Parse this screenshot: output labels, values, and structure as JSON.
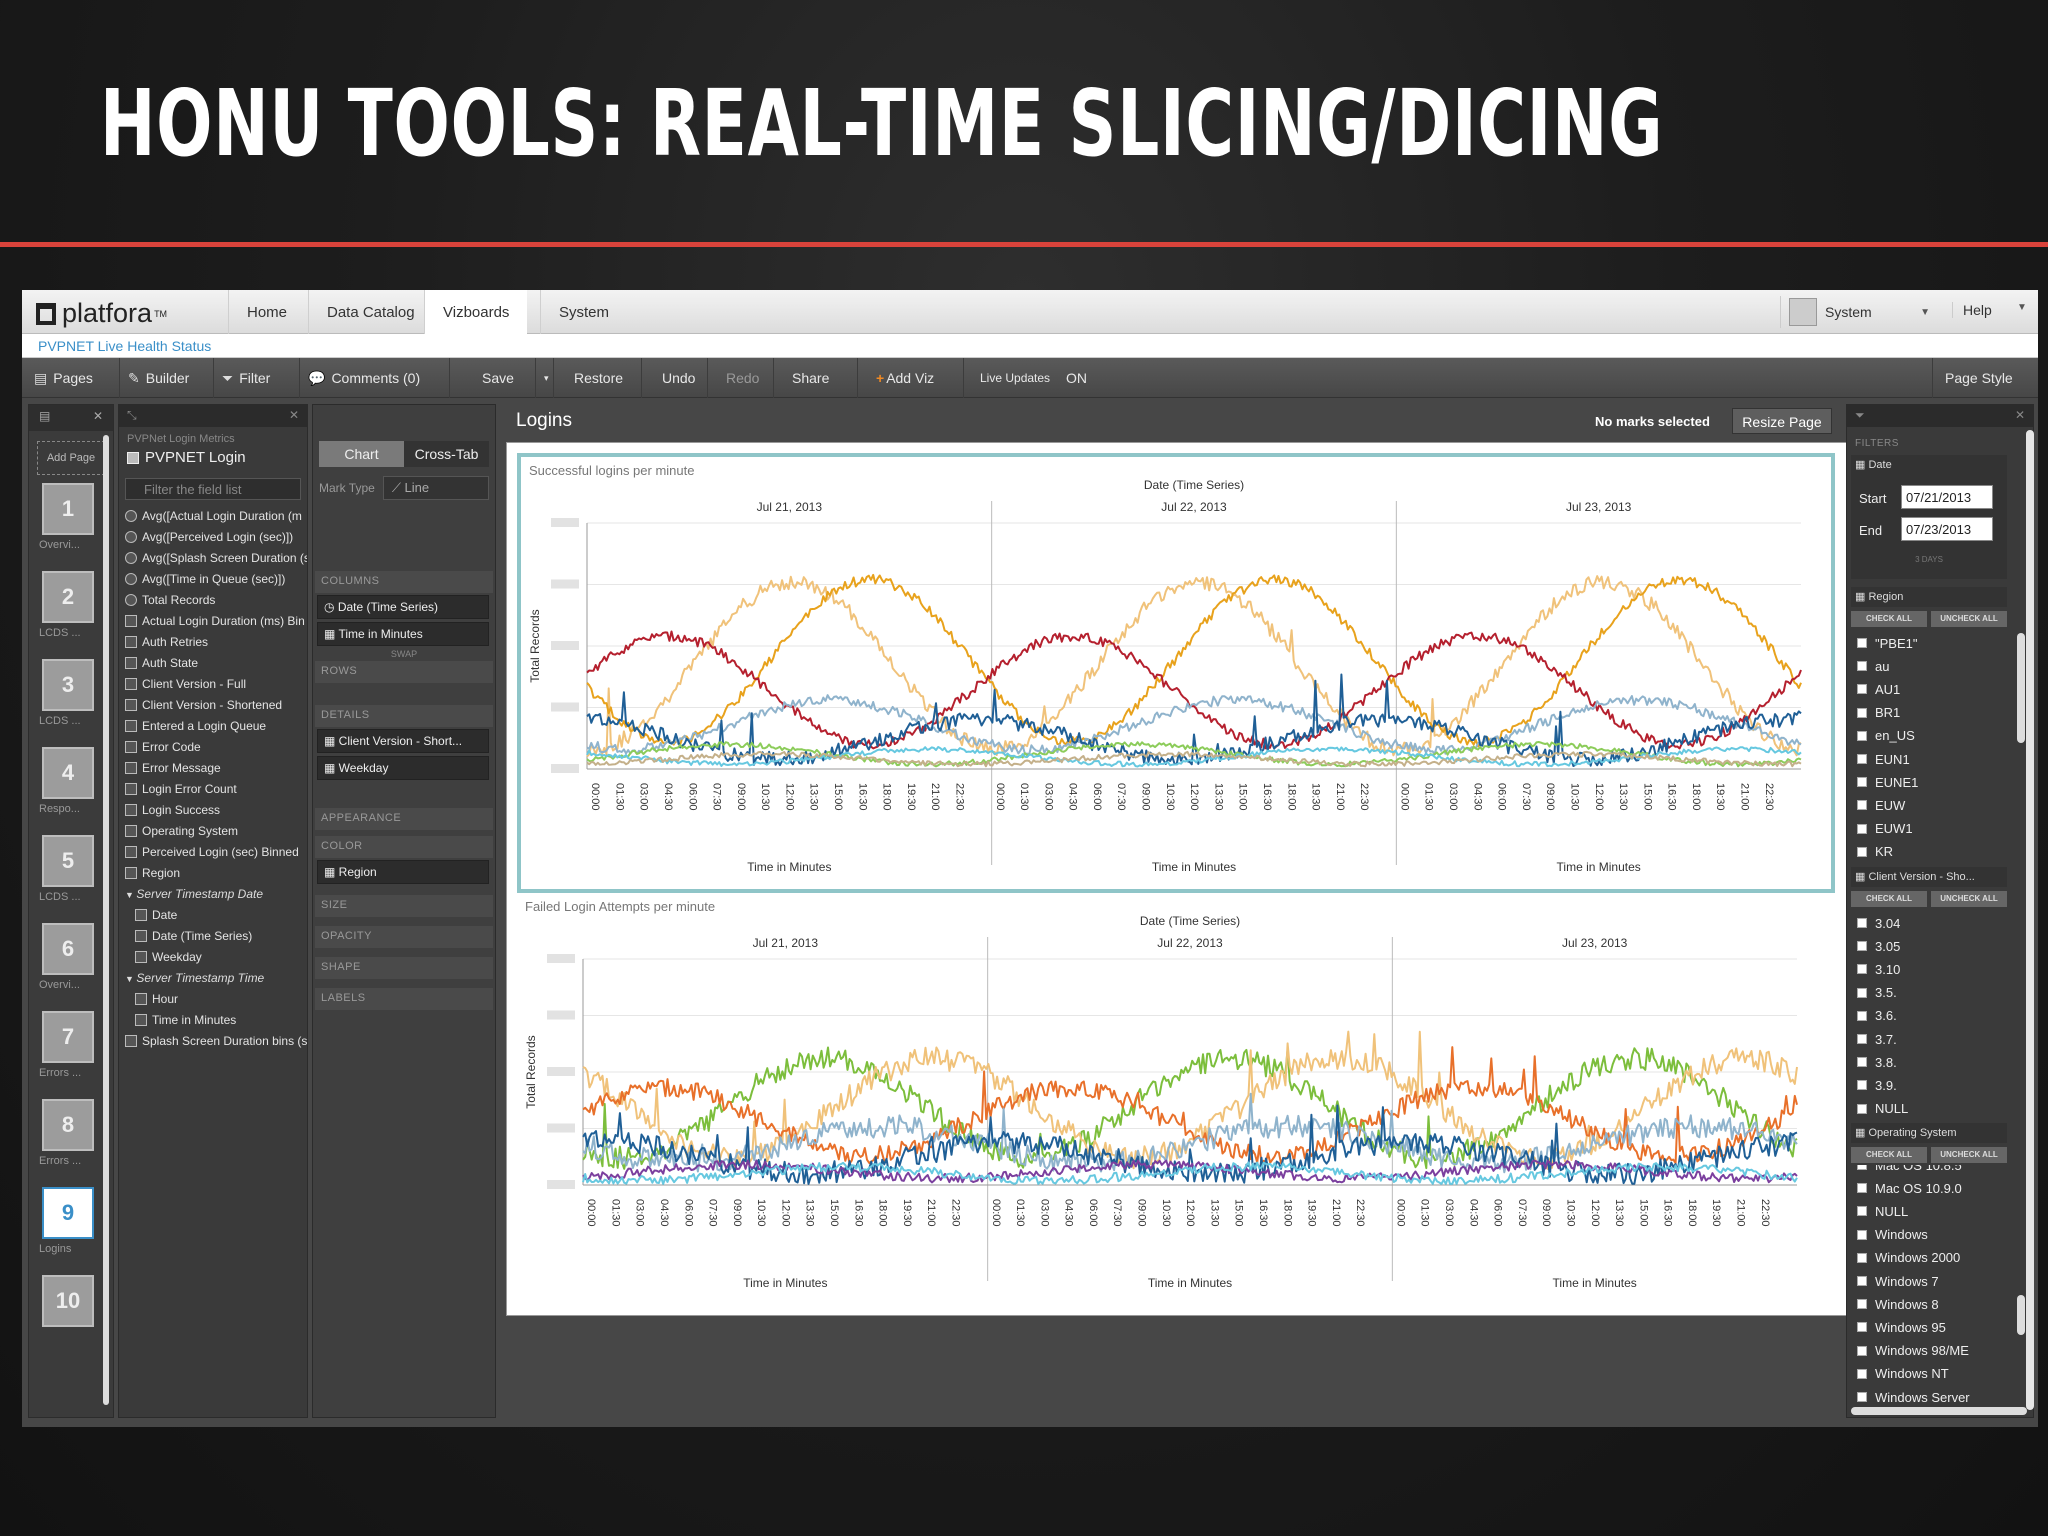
{
  "slide": {
    "title": "HONU TOOLS: REAL-TIME SLICING/DICING"
  },
  "app": {
    "logo": "platfora",
    "logo_mark": "TM",
    "nav": [
      "Home",
      "Data Catalog",
      "Vizboards",
      "System"
    ],
    "active_nav": "Vizboards",
    "user": "System",
    "help": "Help",
    "breadcrumb": "PVPNET Live Health Status"
  },
  "toolbar": {
    "pages": "Pages",
    "builder": "Builder",
    "filter": "Filter",
    "comments": "Comments (0)",
    "save": "Save",
    "restore": "Restore",
    "undo": "Undo",
    "redo": "Redo",
    "share": "Share",
    "add_viz": "Add Viz",
    "live_updates": "Live Updates",
    "live_state": "ON",
    "page_style": "Page Style"
  },
  "pages_panel": {
    "add_page": "Add Page",
    "pages": [
      {
        "num": "1",
        "label": "Overvi..."
      },
      {
        "num": "2",
        "label": "LCDS ..."
      },
      {
        "num": "3",
        "label": "LCDS ..."
      },
      {
        "num": "4",
        "label": "Respo..."
      },
      {
        "num": "5",
        "label": "LCDS ..."
      },
      {
        "num": "6",
        "label": "Overvi..."
      },
      {
        "num": "7",
        "label": "Errors ..."
      },
      {
        "num": "8",
        "label": "Errors ..."
      },
      {
        "num": "9",
        "label": "Logins"
      },
      {
        "num": "10",
        "label": ""
      }
    ],
    "active": "9"
  },
  "fields_panel": {
    "subtitle": "PVPNet Login Metrics",
    "dataset": "PVPNET Login",
    "filter_placeholder": "Filter the field list",
    "fields": [
      {
        "label": "Avg([Actual Login Duration (m",
        "kind": "measure"
      },
      {
        "label": "Avg([Perceived Login (sec)])",
        "kind": "measure"
      },
      {
        "label": "Avg([Splash Screen Duration (s",
        "kind": "measure"
      },
      {
        "label": "Avg([Time in Queue (sec)])",
        "kind": "measure"
      },
      {
        "label": "Total Records",
        "kind": "measure"
      },
      {
        "label": "Actual Login Duration (ms) Bin",
        "kind": "dim"
      },
      {
        "label": "Auth Retries",
        "kind": "dim"
      },
      {
        "label": "Auth State",
        "kind": "dim"
      },
      {
        "label": "Client Version - Full",
        "kind": "dim"
      },
      {
        "label": "Client Version - Shortened",
        "kind": "dim"
      },
      {
        "label": "Entered a Login Queue",
        "kind": "dim"
      },
      {
        "label": "Error Code",
        "kind": "dim"
      },
      {
        "label": "Error Message",
        "kind": "dim"
      },
      {
        "label": "Login Error Count",
        "kind": "dim"
      },
      {
        "label": "Login Success",
        "kind": "dim"
      },
      {
        "label": "Operating System",
        "kind": "dim"
      },
      {
        "label": "Perceived Login (sec) Binned",
        "kind": "dim"
      },
      {
        "label": "Region",
        "kind": "dim"
      },
      {
        "label": "Server Timestamp Date",
        "kind": "group"
      },
      {
        "label": "Date",
        "kind": "child"
      },
      {
        "label": "Date (Time Series)",
        "kind": "child"
      },
      {
        "label": "Weekday",
        "kind": "child"
      },
      {
        "label": "Server Timestamp Time",
        "kind": "group"
      },
      {
        "label": "Hour",
        "kind": "child"
      },
      {
        "label": "Time in Minutes",
        "kind": "child"
      },
      {
        "label": "Splash Screen Duration bins (s",
        "kind": "dim"
      }
    ]
  },
  "builder_panel": {
    "tab_chart": "Chart",
    "tab_crosstab": "Cross-Tab",
    "mark_type_label": "Mark Type",
    "mark_type": "Line",
    "columns": "COLUMNS",
    "col1": "Date (Time Series)",
    "col2": "Time in Minutes",
    "swap": "SWAP",
    "rows": "ROWS",
    "details": "DETAILS",
    "det1": "Client Version - Short...",
    "det2": "Weekday",
    "appearance": "APPEARANCE",
    "color": "COLOR",
    "color_field": "Region",
    "size": "SIZE",
    "opacity": "OPACITY",
    "shape": "SHAPE",
    "labels": "LABELS"
  },
  "canvas": {
    "title": "Logins",
    "marks_status": "No marks selected",
    "resize": "Resize Page"
  },
  "filters_panel": {
    "header": "FILTERS",
    "date_label": "Date",
    "start_label": "Start",
    "start_value": "07/21/2013",
    "end_label": "End",
    "end_value": "07/23/2013",
    "days_note": "3 DAYS",
    "check_all": "CHECK ALL",
    "uncheck_all": "UNCHECK ALL",
    "region_title": "Region",
    "regions": [
      "\"PBE1\"",
      "au",
      "AU1",
      "BR1",
      "en_US",
      "EUN1",
      "EUNE1",
      "EUW",
      "EUW1",
      "KR"
    ],
    "client_title": "Client Version - Sho...",
    "clients": [
      "3.04",
      "3.05",
      "3.10",
      "3.5.",
      "3.6.",
      "3.7.",
      "3.8.",
      "3.9.",
      "NULL"
    ],
    "os_title": "Operating System",
    "os": [
      "Mac OS 10.8.5",
      "Mac OS 10.9.0",
      "NULL",
      "Windows",
      "Windows 2000",
      "Windows 7",
      "Windows 8",
      "Windows 95",
      "Windows 98/ME",
      "Windows NT",
      "Windows Server"
    ]
  },
  "chart_data": [
    {
      "type": "line",
      "title": "Successful logins per minute",
      "super_xlabel": "Date (Time Series)",
      "panels": [
        "Jul 21, 2013",
        "Jul 22, 2013",
        "Jul 23, 2013"
      ],
      "x_ticks": [
        "00:00",
        "01:30",
        "03:00",
        "04:30",
        "06:00",
        "07:30",
        "09:00",
        "10:30",
        "12:00",
        "13:30",
        "15:00",
        "16:30",
        "18:00",
        "19:30",
        "21:00",
        "22:30"
      ],
      "xlabel": "Time in Minutes",
      "ylabel": "Total Records",
      "color_by": "Region",
      "series": [
        {
          "color": "#f0c27a",
          "phase": 0.26,
          "amp": 0.34,
          "base": 0.42,
          "noise": 0.03
        },
        {
          "color": "#e8a21c",
          "phase": 0.45,
          "amp": 0.33,
          "base": 0.44,
          "noise": 0.02
        },
        {
          "color": "#b5202e",
          "phase": 0.95,
          "amp": 0.22,
          "base": 0.32,
          "noise": 0.02
        },
        {
          "color": "#8fb3cc",
          "phase": 0.35,
          "amp": 0.1,
          "base": 0.18,
          "noise": 0.02
        },
        {
          "color": "#1f5f96",
          "phase": 0.72,
          "amp": 0.08,
          "base": 0.12,
          "noise": 0.03
        },
        {
          "color": "#8ccc5a",
          "phase": 0.1,
          "amp": 0.04,
          "base": 0.06,
          "noise": 0.01
        },
        {
          "color": "#66c8e0",
          "phase": 0.6,
          "amp": 0.03,
          "base": 0.05,
          "noise": 0.01
        },
        {
          "color": "#c4b08a",
          "phase": 0.2,
          "amp": 0.02,
          "base": 0.04,
          "noise": 0.01
        }
      ]
    },
    {
      "type": "line",
      "title": "Failed Login Attempts per minute",
      "super_xlabel": "Date (Time Series)",
      "panels": [
        "Jul 21, 2013",
        "Jul 22, 2013",
        "Jul 23, 2013"
      ],
      "x_ticks": [
        "00:00",
        "01:30",
        "03:00",
        "04:30",
        "06:00",
        "07:30",
        "09:00",
        "10:30",
        "12:00",
        "13:30",
        "15:00",
        "16:30",
        "18:00",
        "19:30",
        "21:00",
        "22:30"
      ],
      "xlabel": "Time in Minutes",
      "ylabel": "Total Records",
      "color_by": "Region",
      "series": [
        {
          "color": "#7cbe3c",
          "phase": 0.35,
          "amp": 0.22,
          "base": 0.34,
          "noise": 0.05
        },
        {
          "color": "#f0c27a",
          "phase": 0.62,
          "amp": 0.22,
          "base": 0.34,
          "noise": 0.05
        },
        {
          "color": "#e8702a",
          "phase": 0.95,
          "amp": 0.15,
          "base": 0.28,
          "noise": 0.04
        },
        {
          "color": "#8fb3cc",
          "phase": 0.5,
          "amp": 0.08,
          "base": 0.18,
          "noise": 0.05
        },
        {
          "color": "#1f5f96",
          "phase": 0.8,
          "amp": 0.07,
          "base": 0.12,
          "noise": 0.05
        },
        {
          "color": "#7b3f9e",
          "phase": 0.15,
          "amp": 0.03,
          "base": 0.06,
          "noise": 0.02
        },
        {
          "color": "#66c8e0",
          "phase": 0.4,
          "amp": 0.03,
          "base": 0.05,
          "noise": 0.02
        }
      ]
    }
  ]
}
